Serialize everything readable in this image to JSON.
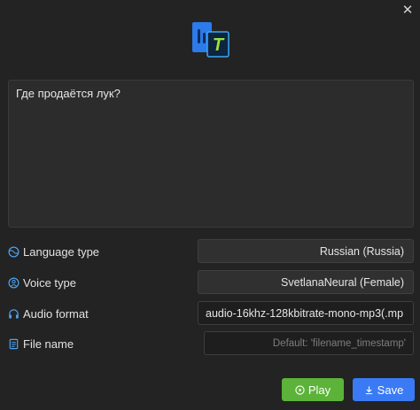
{
  "window": {
    "close_glyph": "✕"
  },
  "logo": {
    "letter": "T",
    "colors": {
      "dark": "#1f6fe0",
      "light": "#45c2f5",
      "accent": "#9be23a"
    }
  },
  "text_input": {
    "value": "Где продаётся лук?"
  },
  "fields": {
    "language": {
      "label": "Language type",
      "value": "Russian (Russia)",
      "icon": "globe-icon"
    },
    "voice": {
      "label": "Voice type",
      "value": "SvetlanaNeural (Female)",
      "icon": "person-icon"
    },
    "format": {
      "label": "Audio format",
      "value": "audio-16khz-128kbitrate-mono-mp3(.mp",
      "icon": "headphones-icon"
    },
    "filename": {
      "label": "File name",
      "placeholder": "Default: 'filename_timestamp'",
      "icon": "file-icon"
    }
  },
  "buttons": {
    "play": {
      "label": "Play",
      "color": "#5cb339"
    },
    "save": {
      "label": "Save",
      "color": "#3a7bf5"
    }
  }
}
